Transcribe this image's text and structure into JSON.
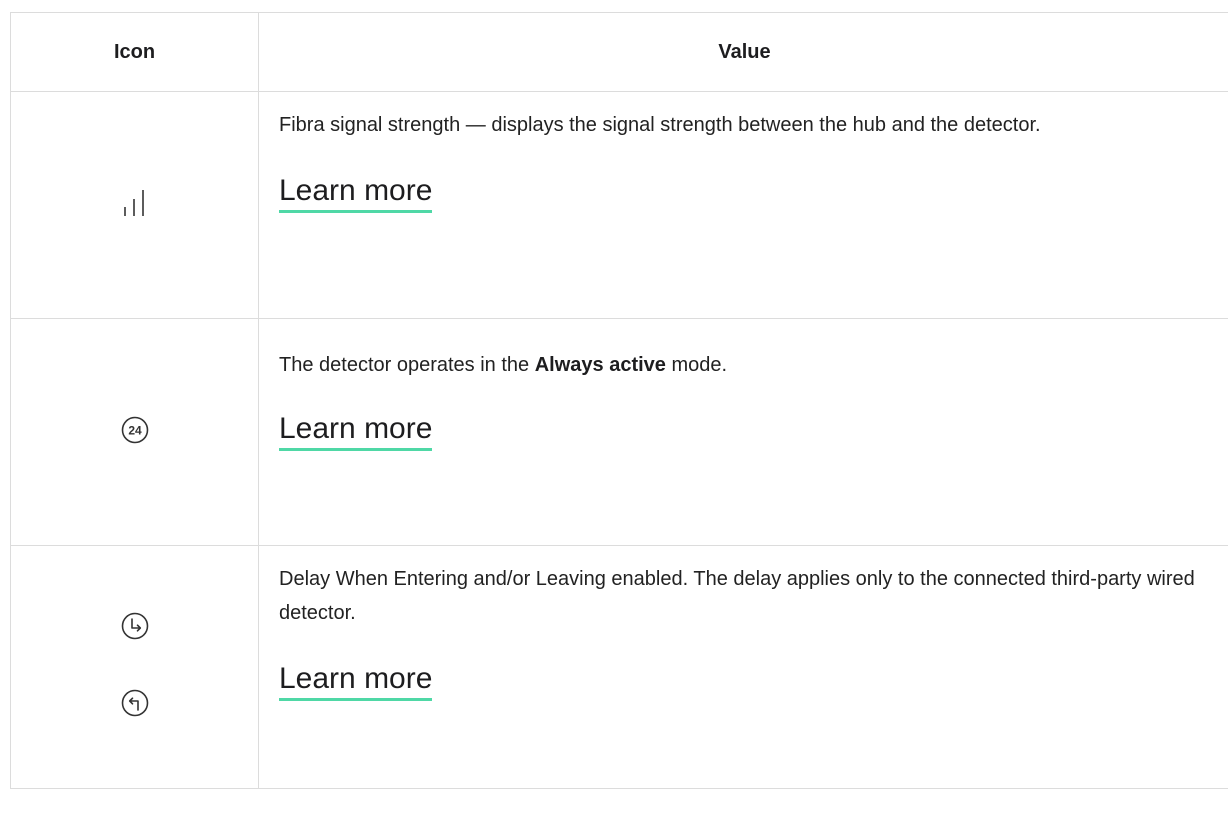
{
  "table": {
    "headers": {
      "icon": "Icon",
      "value": "Value"
    },
    "rows": [
      {
        "icons": [
          "signal-strength-icon"
        ],
        "text_before": "Fibra signal strength — displays the signal strength between the hub and the detector.",
        "bold": "",
        "text_after": "",
        "link": "Learn more"
      },
      {
        "icons": [
          "always-active-24-icon"
        ],
        "icon_text": "24",
        "text_before": "The detector operates in the ",
        "bold": "Always active",
        "text_after": " mode.",
        "link": "Learn more"
      },
      {
        "icons": [
          "delay-entering-icon",
          "delay-leaving-icon"
        ],
        "text_before": "Delay When Entering and/or Leaving enabled. The delay applies only to the connected third-party wired detector.",
        "bold": "",
        "text_after": "",
        "link": "Learn more"
      }
    ]
  },
  "colors": {
    "link_underline": "#4fd8a6",
    "border": "#dcdcdc",
    "text": "#1d1d1f"
  }
}
